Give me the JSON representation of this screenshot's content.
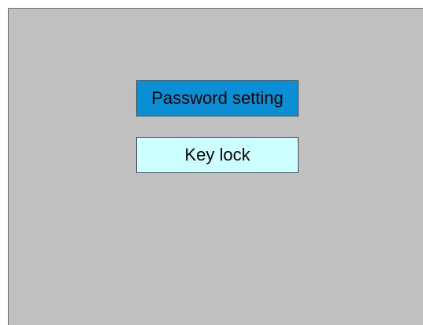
{
  "menu": {
    "items": [
      {
        "label": "Password setting",
        "selected": true,
        "background": "#0a8fd6"
      },
      {
        "label": "Key lock",
        "selected": false,
        "background": "#ccffff"
      }
    ]
  },
  "colors": {
    "screen_background": "#c0c0c0",
    "selected_item": "#0a8fd6",
    "unselected_item": "#ccffff",
    "border": "#4a4a4a"
  }
}
